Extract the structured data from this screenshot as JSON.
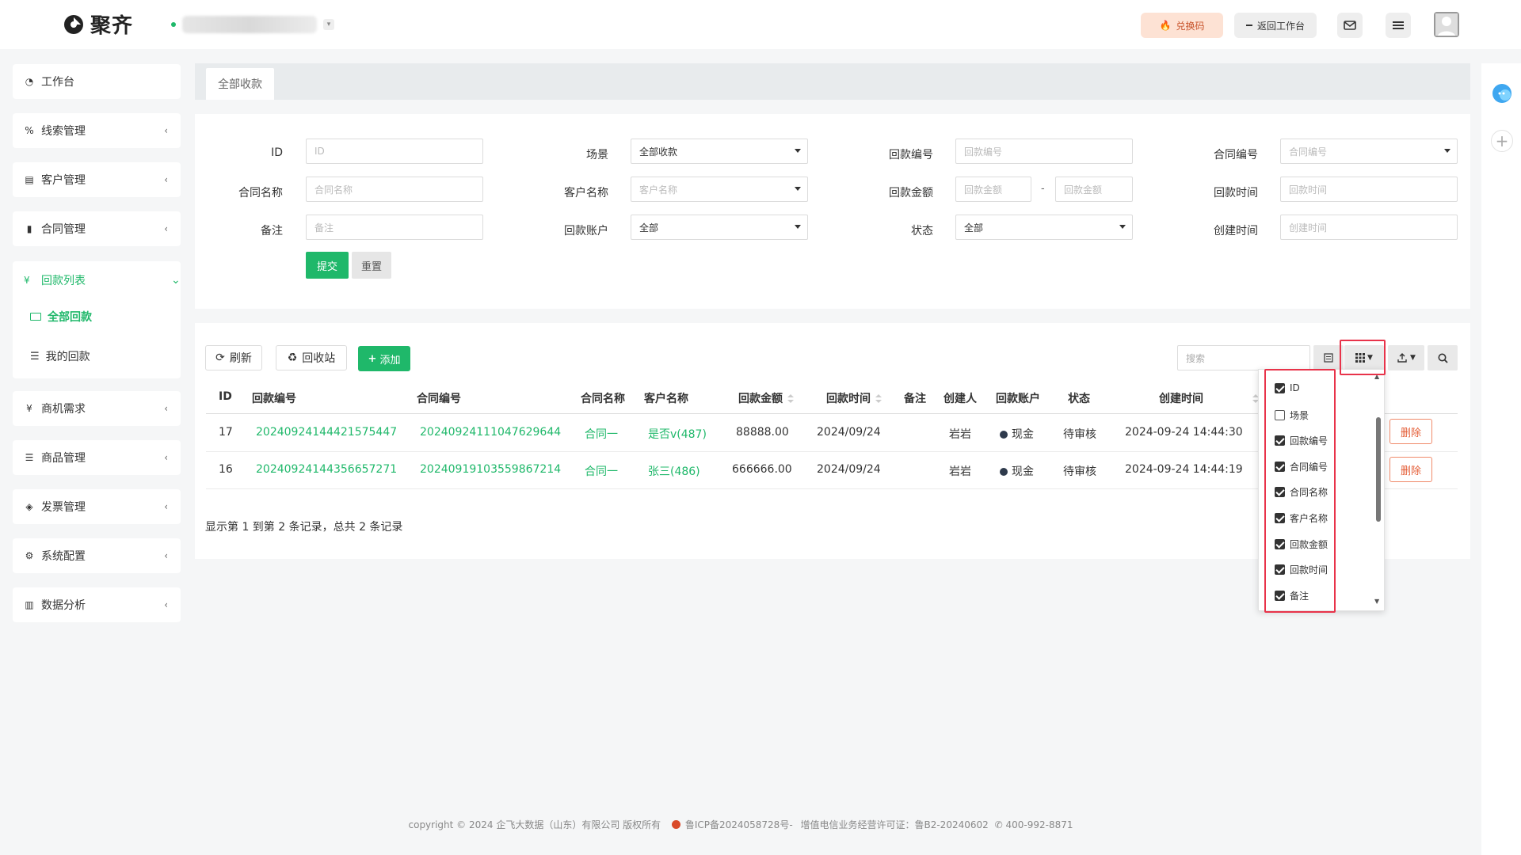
{
  "header": {
    "logo_text": "聚齐",
    "redeem_label": "兑换码",
    "back_label": "返回工作台"
  },
  "sidebar": {
    "items": [
      {
        "label": "工作台",
        "icon": "dashboard-icon"
      },
      {
        "label": "线索管理",
        "icon": "link-icon"
      },
      {
        "label": "客户管理",
        "icon": "id-card-icon"
      },
      {
        "label": "合同管理",
        "icon": "bookmark-icon"
      },
      {
        "label": "回款列表",
        "icon": "yen-icon"
      },
      {
        "label": "商机需求",
        "icon": "yen-icon"
      },
      {
        "label": "商品管理",
        "icon": "list-icon"
      },
      {
        "label": "发票管理",
        "icon": "tag-icon"
      },
      {
        "label": "系统配置",
        "icon": "gears-icon"
      },
      {
        "label": "数据分析",
        "icon": "bar-chart-icon"
      }
    ],
    "sub_items": [
      {
        "label": "全部回款",
        "active": true
      },
      {
        "label": "我的回款",
        "active": false
      }
    ]
  },
  "tabs": {
    "active": "全部收款"
  },
  "filters": {
    "id": {
      "label": "ID",
      "placeholder": "ID"
    },
    "scene": {
      "label": "场景",
      "value": "全部收款"
    },
    "payment_no": {
      "label": "回款编号",
      "placeholder": "回款编号"
    },
    "contract_no": {
      "label": "合同编号",
      "placeholder": "合同编号"
    },
    "contract_name": {
      "label": "合同名称",
      "placeholder": "合同名称"
    },
    "customer_name": {
      "label": "客户名称",
      "placeholder": "客户名称"
    },
    "amount": {
      "label": "回款金额",
      "placeholder_min": "回款金额",
      "placeholder_max": "回款金额",
      "sep": "-"
    },
    "payment_time": {
      "label": "回款时间",
      "placeholder": "回款时间"
    },
    "remark": {
      "label": "备注",
      "placeholder": "备注"
    },
    "account": {
      "label": "回款账户",
      "value": "全部"
    },
    "status": {
      "label": "状态",
      "value": "全部"
    },
    "create_time": {
      "label": "创建时间",
      "placeholder": "创建时间"
    },
    "submit_label": "提交",
    "reset_label": "重置"
  },
  "toolbar": {
    "refresh_label": "刷新",
    "recycle_label": "回收站",
    "add_label": "添加",
    "search_placeholder": "搜索"
  },
  "table": {
    "columns": [
      "ID",
      "回款编号",
      "合同编号",
      "合同名称",
      "客户名称",
      "回款金额",
      "回款时间",
      "备注",
      "创建人",
      "回款账户",
      "状态",
      "创建时间"
    ],
    "rows": [
      {
        "id": "17",
        "payment_no": "20240924144421575447",
        "contract_no": "20240924111047629644",
        "contract_name": "合同一",
        "customer": "是否v(487)",
        "amount": "88888.00",
        "pay_time": "2024/09/24",
        "remark": "",
        "creator": "岩岩",
        "account": "现金",
        "status": "待审核",
        "created": "2024-09-24 14:44:30",
        "action": "删除"
      },
      {
        "id": "16",
        "payment_no": "20240924144356657271",
        "contract_no": "20240919103559867214",
        "contract_name": "合同一",
        "customer": "张三(486)",
        "amount": "666666.00",
        "pay_time": "2024/09/24",
        "remark": "",
        "creator": "岩岩",
        "account": "现金",
        "status": "待审核",
        "created": "2024-09-24 14:44:19",
        "action": "删除"
      }
    ],
    "pager_text": "显示第 1 到第 2 条记录，总共 2 条记录"
  },
  "column_menu": [
    {
      "label": "ID",
      "checked": true
    },
    {
      "label": "场景",
      "checked": false
    },
    {
      "label": "回款编号",
      "checked": true
    },
    {
      "label": "合同编号",
      "checked": true
    },
    {
      "label": "合同名称",
      "checked": true
    },
    {
      "label": "客户名称",
      "checked": true
    },
    {
      "label": "回款金额",
      "checked": true
    },
    {
      "label": "回款时间",
      "checked": true
    },
    {
      "label": "备注",
      "checked": true
    }
  ],
  "footer": {
    "copyright": "copyright © 2024 企飞大数据（山东）有限公司 版权所有",
    "icp": "鲁ICP备2024058728号-",
    "license": "增值电信业务经营许可证：鲁B2-20240602",
    "phone": "400-992-8871"
  },
  "colors": {
    "brand_green": "#1fb86a",
    "danger": "#e45c35",
    "highlight_red": "#e8334a"
  }
}
